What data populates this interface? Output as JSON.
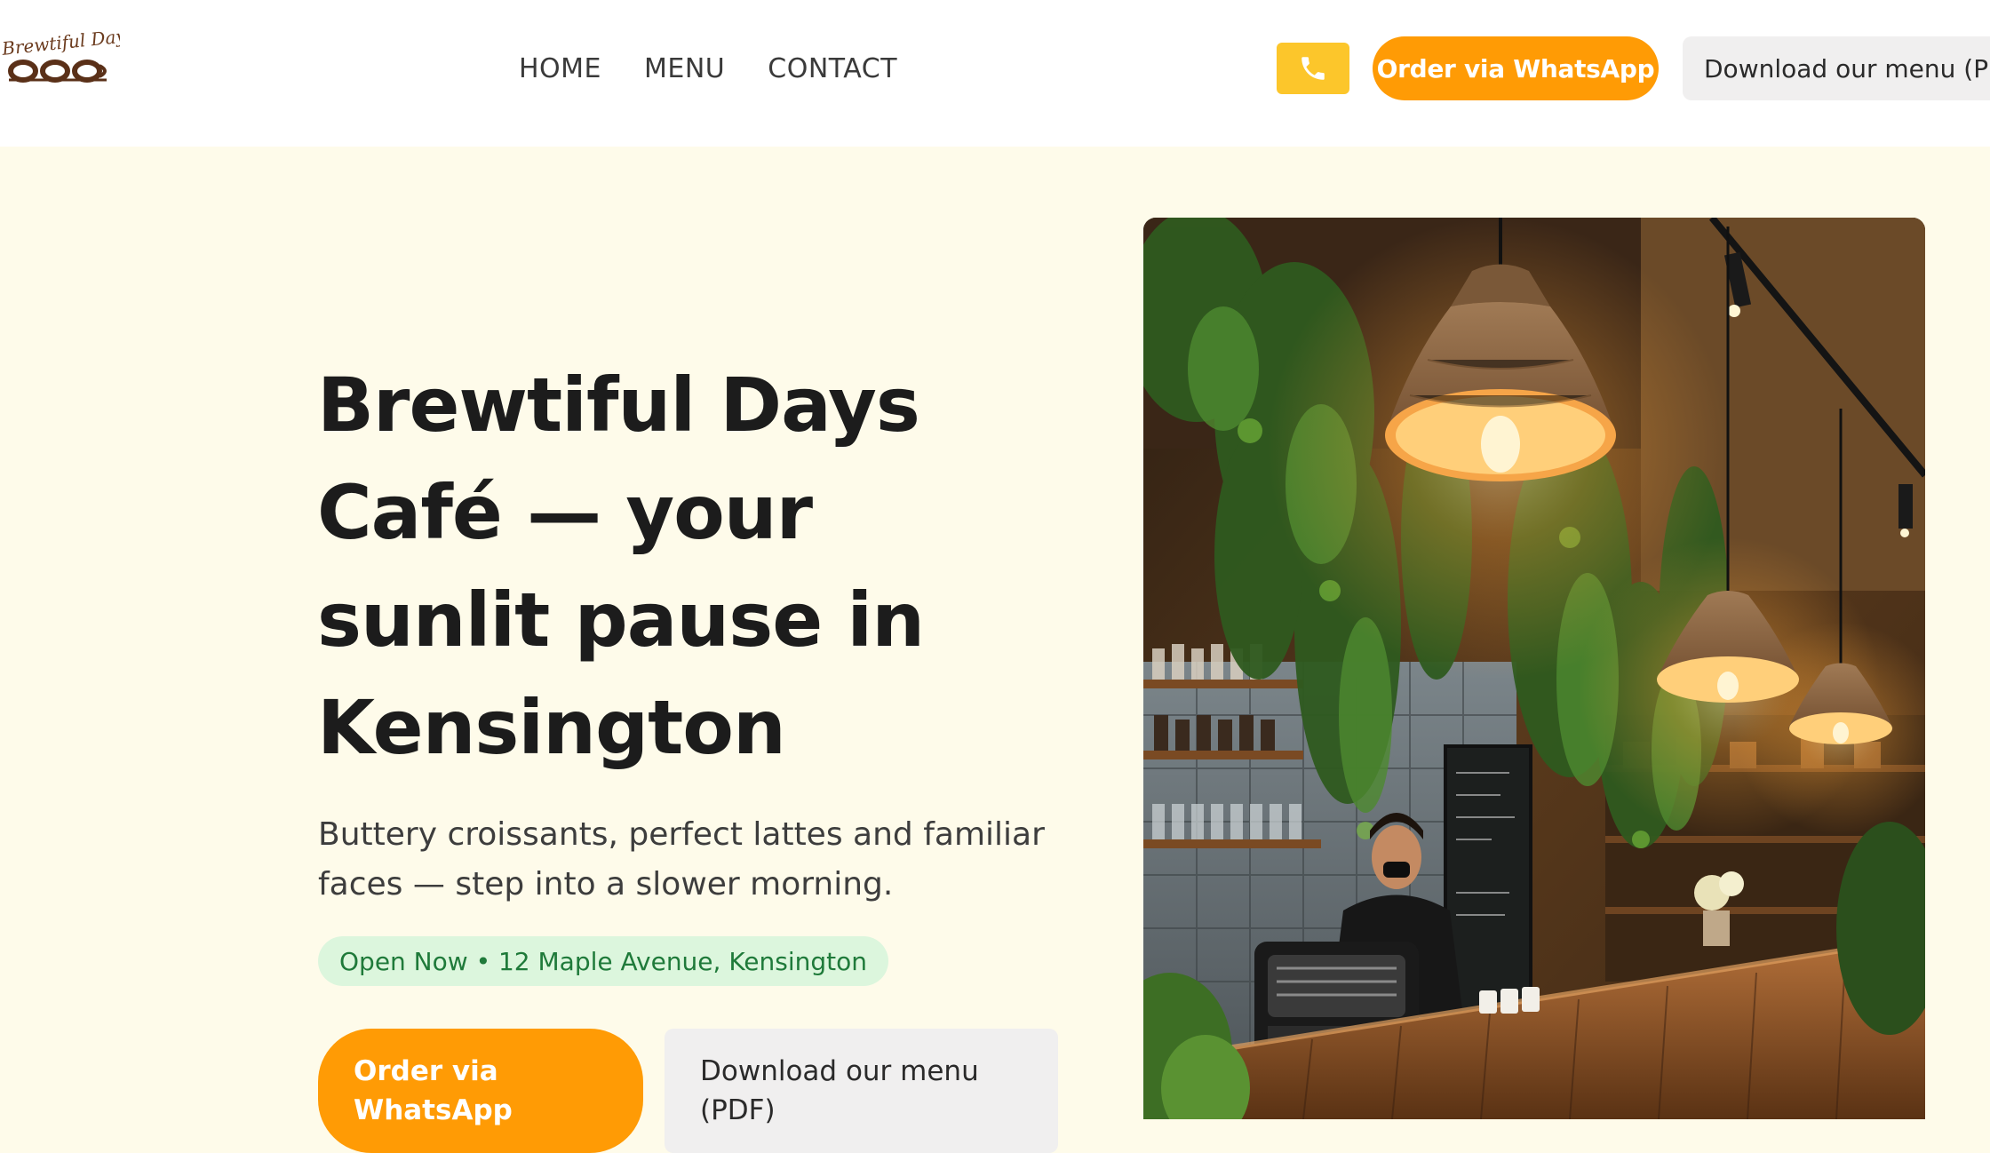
{
  "brand": {
    "logo_text": "Brewtiful Days"
  },
  "nav": {
    "items": [
      {
        "label": "HOME"
      },
      {
        "label": "MENU"
      },
      {
        "label": "CONTACT"
      }
    ]
  },
  "header_actions": {
    "phone_icon": "phone-icon",
    "whatsapp_label": "Order via WhatsApp",
    "menu_pdf_label": "Download our menu (PDF"
  },
  "hero": {
    "title": "Brewtiful Days Café — your sunlit pause in Kensington",
    "subtitle": "Buttery croissants, perfect lattes and familiar faces — step into a slower morning.",
    "status": "Open Now • 12 Maple Avenue, Kensington",
    "whatsapp_label": "Order via WhatsApp",
    "menu_pdf_label": "Download our menu (PDF)"
  },
  "colors": {
    "accent_orange": "#ff9b05",
    "phone_yellow": "#fcc62b",
    "page_cream": "#fefbea",
    "status_green_bg": "#dcf6dd",
    "status_green_text": "#1f7a3a"
  }
}
